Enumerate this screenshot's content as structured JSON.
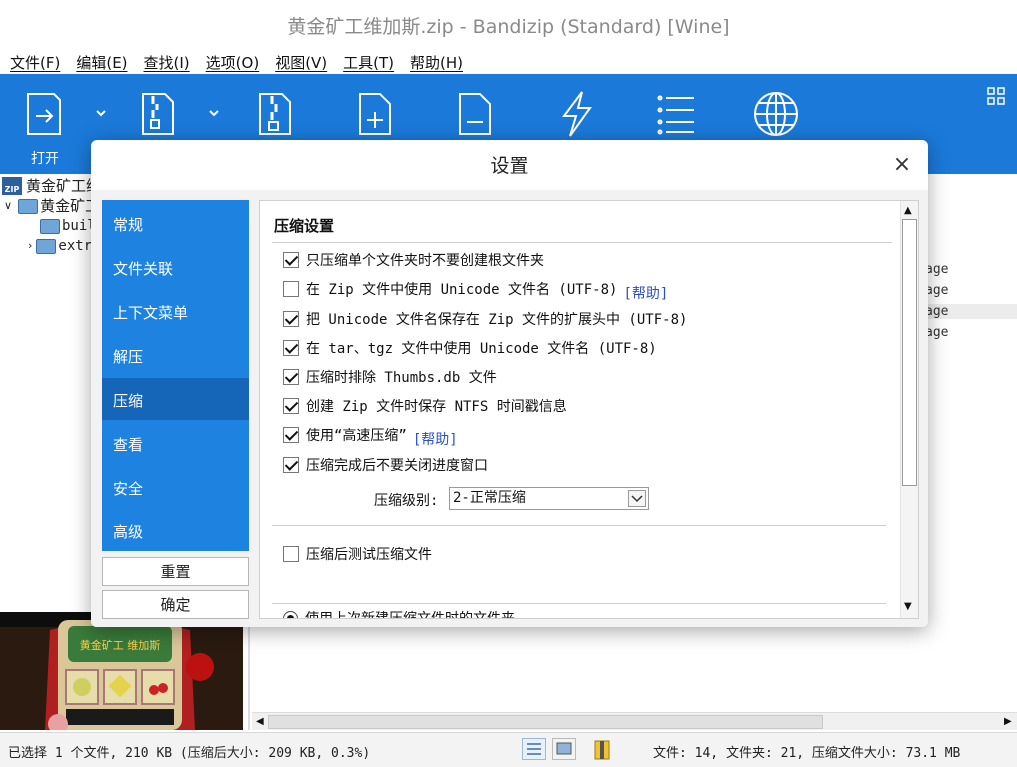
{
  "window": {
    "title": "黄金矿工维加斯.zip - Bandizip (Standard) [Wine]"
  },
  "menu": [
    "文件(F)",
    "编辑(E)",
    "查找(I)",
    "选项(O)",
    "视图(V)",
    "工具(T)",
    "帮助(H)"
  ],
  "toolbar": {
    "open_label": "打开",
    "icons": [
      "open-icon",
      "extract-icon",
      "archive-icon",
      "add-file-icon",
      "delete-file-icon",
      "test-icon",
      "list-icon",
      "globe-icon",
      "view-grid-icon"
    ],
    "accent": "#1b79d9"
  },
  "tree": {
    "root": "黄金矿工维",
    "folder": "黄金矿工",
    "children": [
      "buil",
      "extr"
    ]
  },
  "filelist_fragments": [
    "age",
    "age",
    "age",
    "age"
  ],
  "preview": {
    "caption": "黄金矿工 维加斯"
  },
  "status": {
    "left": "已选择 1 个文件, 210 KB (压缩后大小: 209 KB, 0.3%)",
    "right": "文件: 14, 文件夹: 21, 压缩文件大小: 73.1 MB"
  },
  "dialog": {
    "title": "设置",
    "close": "×",
    "nav": [
      "常规",
      "文件关联",
      "上下文菜单",
      "解压",
      "压缩",
      "查看",
      "安全",
      "高级"
    ],
    "nav_active": "压缩",
    "nav_color": "#1e82e0",
    "reset_label": "重置",
    "ok_label": "确定",
    "section_title": "压缩设置",
    "options": [
      {
        "label": "只压缩单个文件夹时不要创建根文件夹",
        "checked": true,
        "help": ""
      },
      {
        "label": "在 Zip 文件中使用 Unicode 文件名 (UTF-8)",
        "checked": false,
        "help": "[帮助]"
      },
      {
        "label": "把 Unicode 文件名保存在 Zip 文件的扩展头中 (UTF-8)",
        "checked": true,
        "help": ""
      },
      {
        "label": "在 tar、tgz 文件中使用 Unicode 文件名 (UTF-8)",
        "checked": true,
        "help": ""
      },
      {
        "label": "压缩时排除 Thumbs.db 文件",
        "checked": true,
        "help": ""
      },
      {
        "label": "创建 Zip 文件时保存 NTFS 时间戳信息",
        "checked": true,
        "help": ""
      },
      {
        "label": "使用“高速压缩”",
        "checked": true,
        "help": "[帮助]"
      },
      {
        "label": "压缩完成后不要关闭进度窗口",
        "checked": true,
        "help": ""
      }
    ],
    "level_label": "压缩级别:",
    "level_value": "2-正常压缩",
    "test_option": {
      "label": "压缩后测试压缩文件",
      "checked": false
    },
    "folder_option": {
      "label": "使用上次新建压缩文件时的文件夹",
      "checked": true
    }
  }
}
